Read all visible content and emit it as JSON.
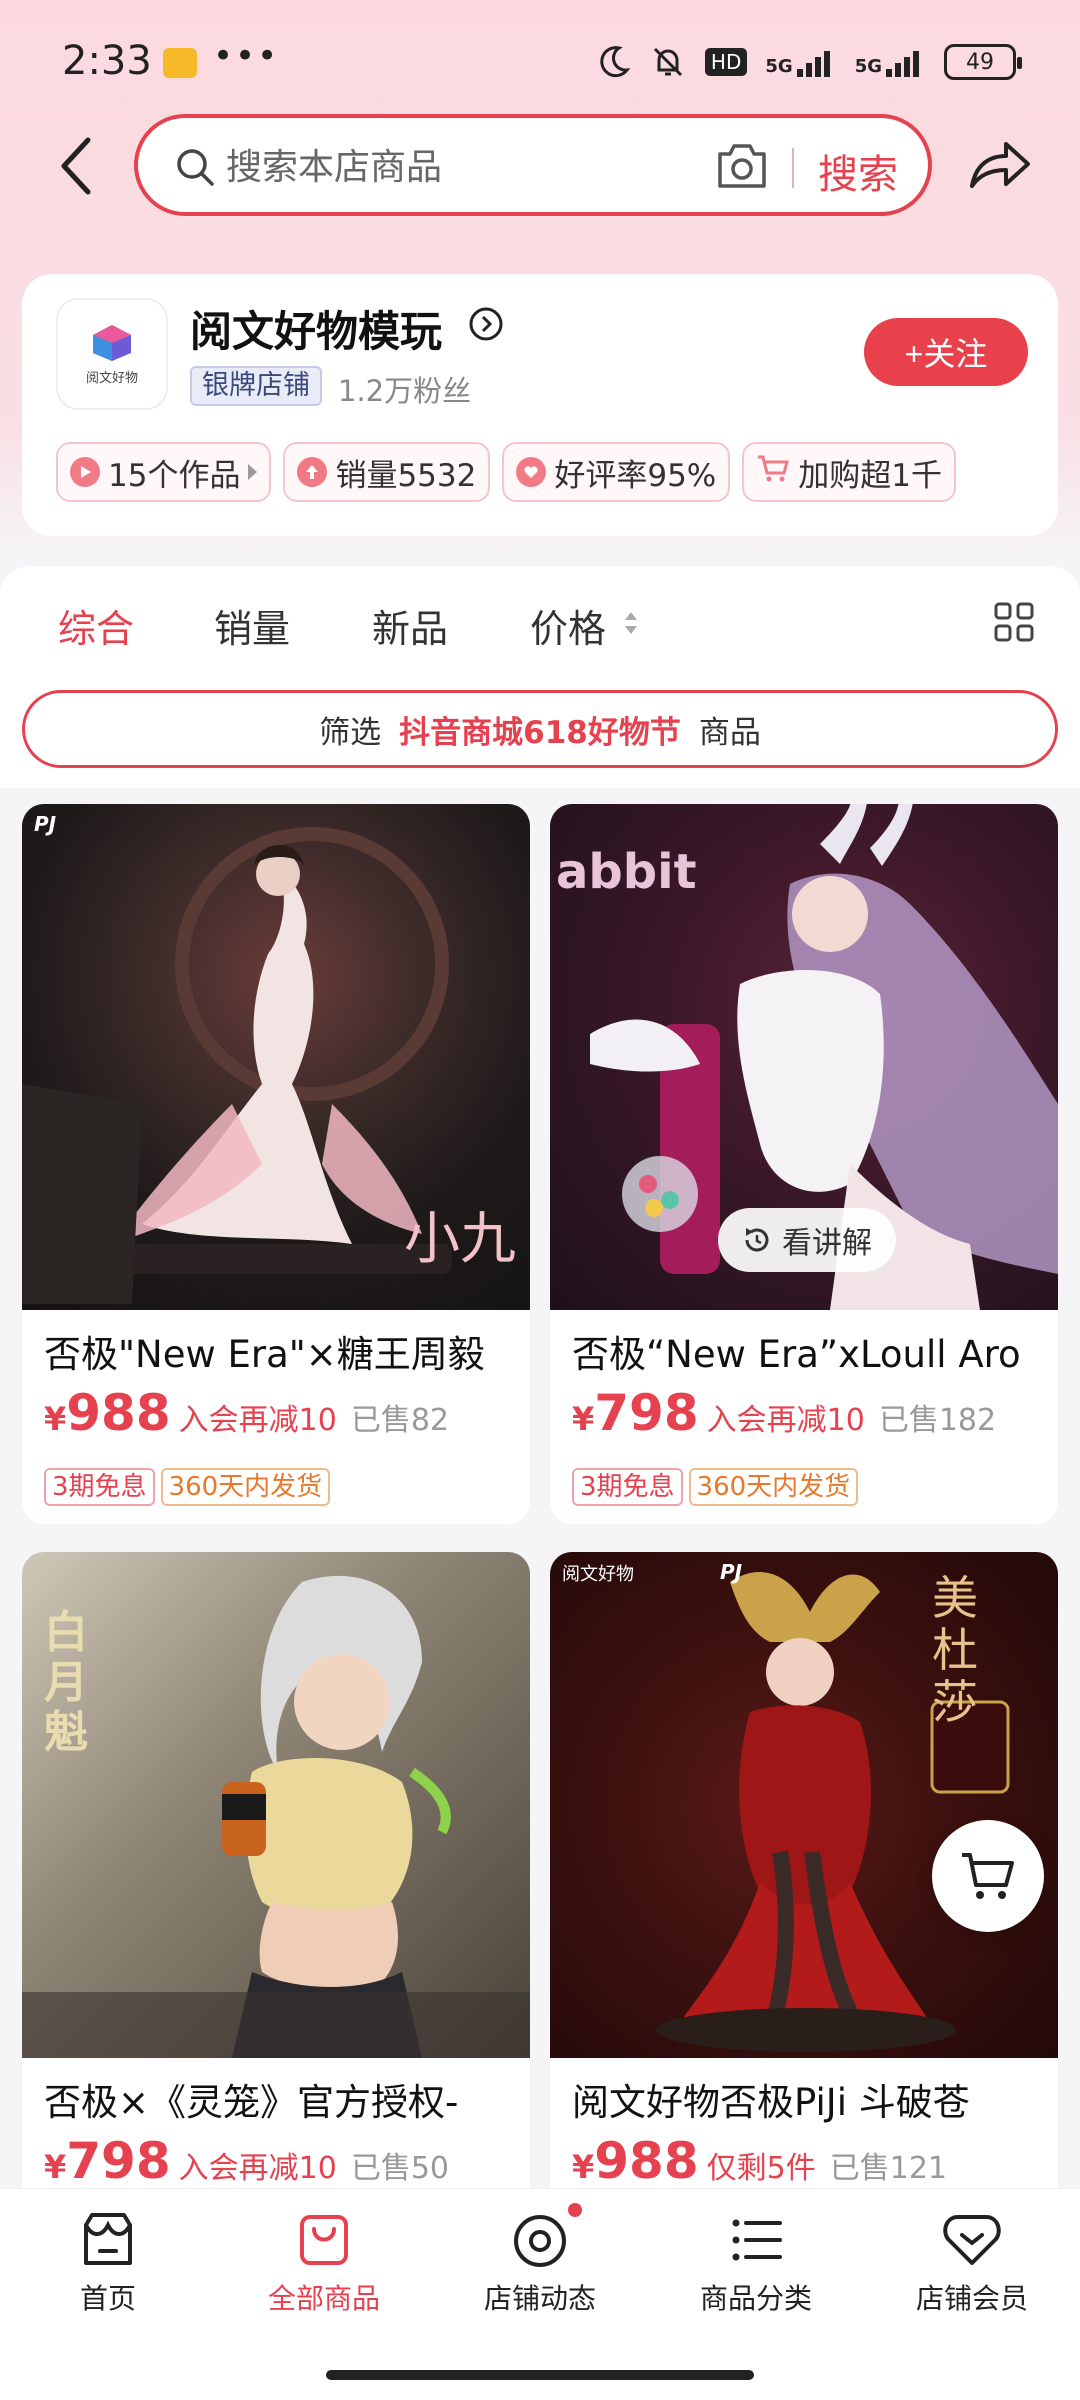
{
  "status_bar": {
    "time": "2:33",
    "dots": "•••",
    "network_1": "5G",
    "network_2": "5G",
    "hd_label": "HD",
    "battery": "49"
  },
  "search": {
    "placeholder": "搜索本店商品",
    "button": "搜索"
  },
  "shop": {
    "logo_text": "阅文好物",
    "name": "阅文好物模玩",
    "badge": "银牌店铺",
    "fans": "1.2万粉丝",
    "follow": "+关注",
    "stats": [
      {
        "label": "15个作品",
        "icon": "play-icon"
      },
      {
        "label": "销量5532",
        "icon": "up-arrow-icon"
      },
      {
        "label": "好评率95%",
        "icon": "heart-icon"
      },
      {
        "label": "加购超1千",
        "icon": "cart-icon"
      }
    ]
  },
  "sort_tabs": [
    "综合",
    "销量",
    "新品",
    "价格"
  ],
  "filter": {
    "prefix": "筛选",
    "highlight": "抖音商城618好物节",
    "suffix": "商品"
  },
  "products": [
    {
      "title": "否极\"New Era\"×糖王周毅",
      "yen": "¥",
      "price": "988",
      "promo": "入会再减10",
      "sold": "已售82",
      "tags": [
        "3期免息",
        "360天内发货"
      ],
      "image_caption": "小九",
      "image_brand": "PJ"
    },
    {
      "title": "否极“New Era”xLoull Aro",
      "yen": "¥",
      "price": "798",
      "promo": "入会再减10",
      "sold": "已售182",
      "tags": [
        "3期免息",
        "360天内发货"
      ],
      "lecture": "看讲解",
      "image_caption": "abbit"
    },
    {
      "title": "否极×《灵笼》官方授权-",
      "yen": "¥",
      "price": "798",
      "promo": "入会再减10",
      "sold": "已售50",
      "tags": [],
      "image_caption": "白月魁"
    },
    {
      "title": "阅文好物否极PiJi 斗破苍",
      "yen": "¥",
      "price": "988",
      "promo": "仅剩5件",
      "sold": "已售121",
      "tags": [],
      "image_caption": "美杜莎",
      "image_brand": "PJ"
    }
  ],
  "bottom_nav": [
    {
      "label": "首页",
      "icon": "home-icon"
    },
    {
      "label": "全部商品",
      "icon": "shopping-bag-icon"
    },
    {
      "label": "店铺动态",
      "icon": "target-icon"
    },
    {
      "label": "商品分类",
      "icon": "list-icon"
    },
    {
      "label": "店铺会员",
      "icon": "member-heart-icon"
    }
  ],
  "colors": {
    "accent": "#e6414f",
    "background_pink": "#fbd9df",
    "panel": "#f5f5f7"
  }
}
